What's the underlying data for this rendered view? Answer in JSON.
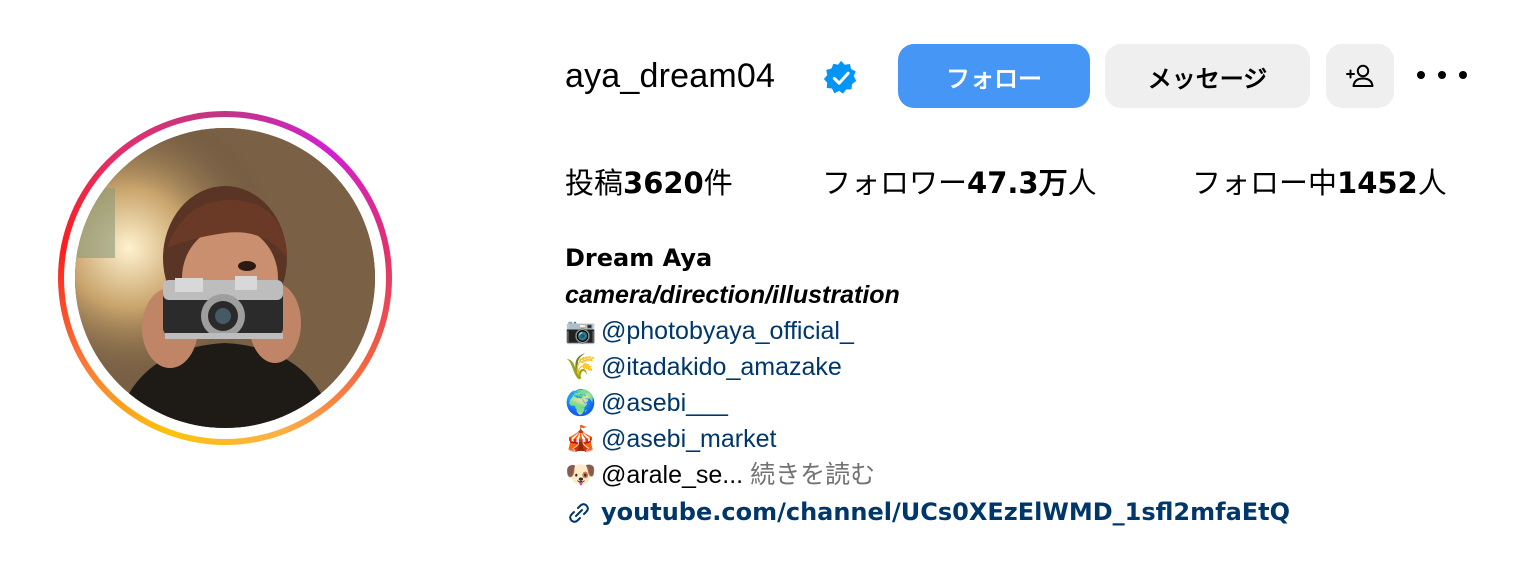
{
  "profile": {
    "username": "aya_dream04",
    "verified": true,
    "buttons": {
      "follow": "フォロー",
      "message": "メッセージ",
      "add_user_icon": "person-add-icon",
      "more_icon": "more-horizontal-icon"
    },
    "stats": {
      "posts_label": "投稿",
      "posts_value": "3620",
      "posts_unit": "件",
      "followers_label": "フォロワー",
      "followers_value": "47.3万",
      "followers_unit": "人",
      "following_label": "フォロー中",
      "following_value": "1452",
      "following_unit": "人"
    },
    "bio": {
      "name": "Dream Aya",
      "tagline": "camera/direction/illustration",
      "lines": [
        {
          "emoji": "📷",
          "text": "@photobyaya_official_"
        },
        {
          "emoji": "🌾",
          "text": "@itadakido_amazake"
        },
        {
          "emoji": "🌍",
          "text": "@asebi___"
        },
        {
          "emoji": "🎪",
          "text": "@asebi_market"
        },
        {
          "emoji": "🐶",
          "text": "@arale_se..."
        }
      ],
      "more_label": "続きを読む",
      "website": "youtube.com/channel/UCs0XEzElWMD_1sfl2mfaEtQ"
    },
    "colors": {
      "follow_button": "#4697f5",
      "secondary_button": "#efefef",
      "link": "#00376b",
      "verified": "#0095f6",
      "muted": "#737373"
    }
  }
}
